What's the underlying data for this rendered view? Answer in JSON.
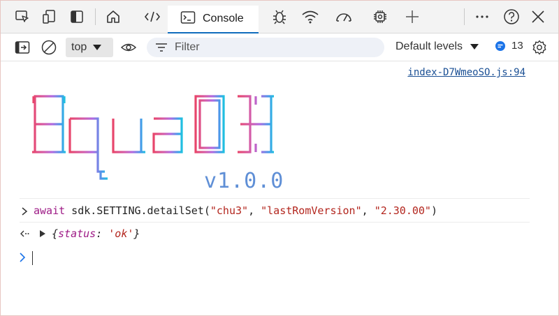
{
  "tabs": {
    "console_label": "Console"
  },
  "toolbar": {
    "context": "top",
    "filter_placeholder": "Filter",
    "levels_label": "Default levels",
    "message_count": "13"
  },
  "console": {
    "source_link": "index-D7WmeoSO.js:94",
    "banner_text": "AquaDX",
    "banner_version": "v1.0.0",
    "command": {
      "kw": "await",
      "pre": " sdk.SETTING.detailSet(",
      "arg1": "\"chu3\"",
      "comma1": ", ",
      "arg2": "\"lastRomVersion\"",
      "comma2": ", ",
      "arg3": "\"2.30.00\"",
      "post": ")"
    },
    "result": {
      "open": "{",
      "key": "status",
      "colon": ": ",
      "value": "'ok'",
      "close": "}"
    }
  },
  "colors": {
    "accent": "#0f6cbd",
    "banner_gradient": [
      "#e8466b",
      "#c85fd0",
      "#4aa8e8",
      "#1fc0e0"
    ]
  }
}
